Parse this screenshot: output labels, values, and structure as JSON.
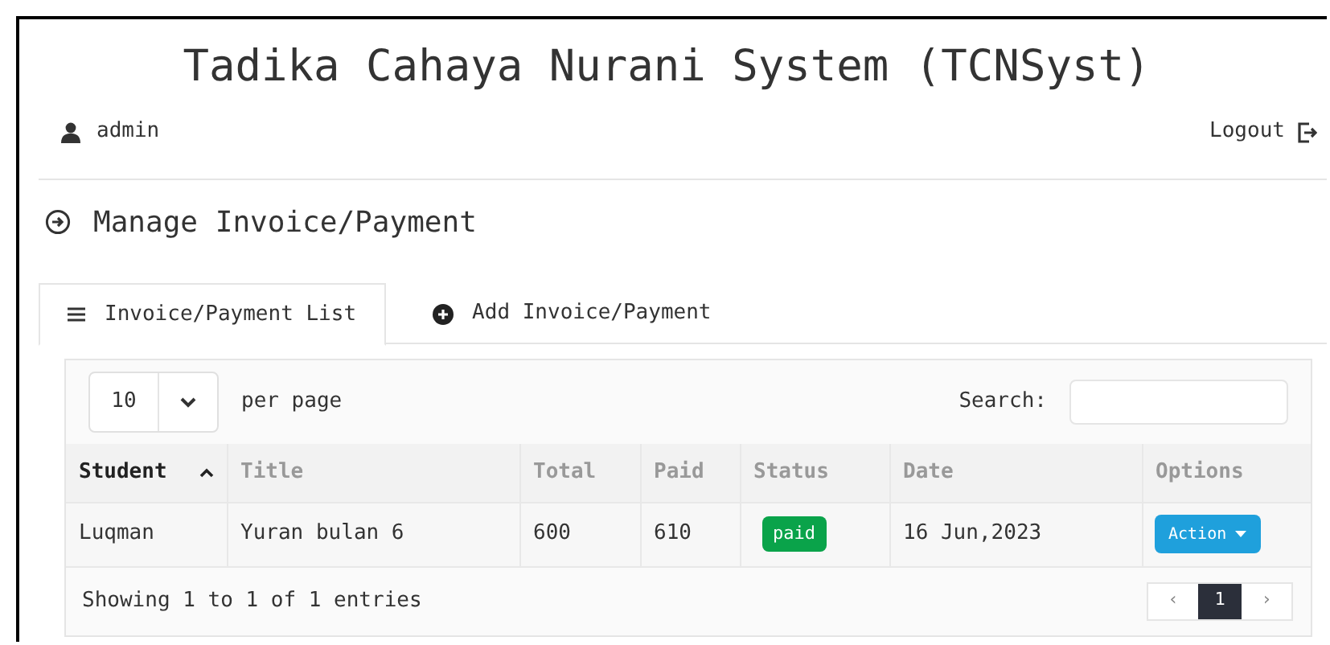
{
  "app_title": "Tadika Cahaya Nurani System (TCNSyst)",
  "user": {
    "name": "admin"
  },
  "logout": "Logout",
  "page_heading": "Manage Invoice/Payment",
  "tabs": [
    {
      "label": "Invoice/Payment List",
      "selected": true
    },
    {
      "label": "Add Invoice/Payment",
      "selected": false
    }
  ],
  "table": {
    "page_size": "10",
    "per_page_label": "per page",
    "search_label": "Search:",
    "columns": [
      {
        "label": "Student",
        "sorted": true
      },
      {
        "label": "Title",
        "sorted": false
      },
      {
        "label": "Total",
        "sorted": false
      },
      {
        "label": "Paid",
        "sorted": false
      },
      {
        "label": "Status",
        "sorted": false
      },
      {
        "label": "Date",
        "sorted": false
      },
      {
        "label": "Options",
        "sorted": false
      }
    ],
    "rows": [
      {
        "student": "Luqman",
        "title": "Yuran bulan 6",
        "total": "600",
        "paid": "610",
        "status": "paid",
        "date": "16 Jun,2023",
        "action": "Action"
      }
    ],
    "summary": "Showing 1 to 1 of 1 entries",
    "pagination": {
      "prev": "‹",
      "pages": [
        {
          "label": "1",
          "selected": true
        }
      ],
      "next": "›"
    }
  }
}
